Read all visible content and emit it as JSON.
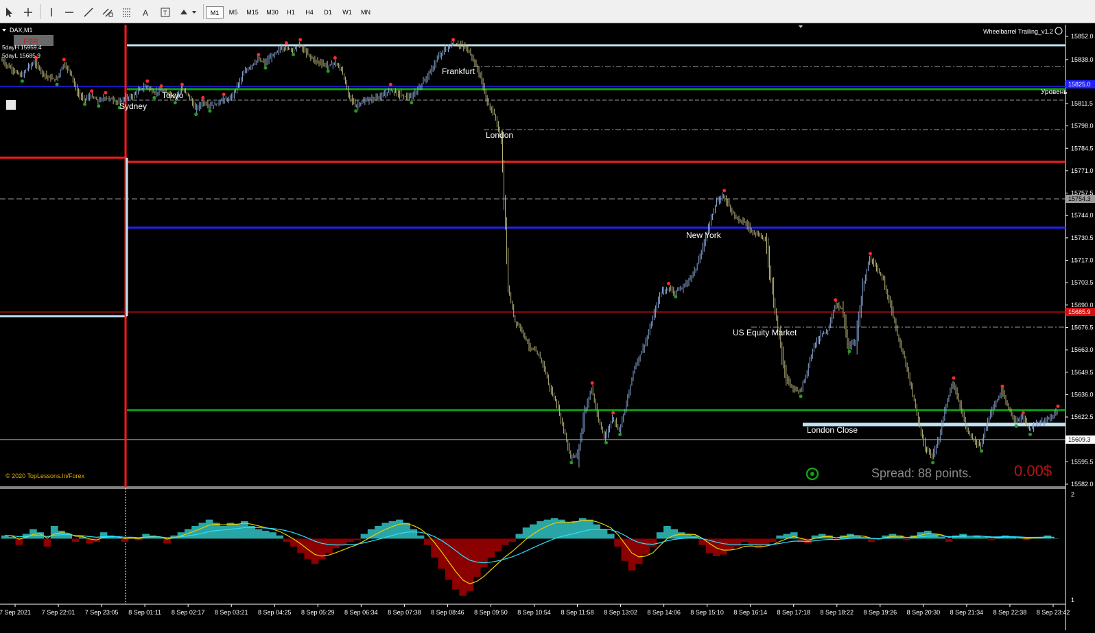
{
  "toolbar": {
    "tools": [
      "cursor-icon",
      "crosshair-icon",
      "vertical-line-icon",
      "horizontal-line-icon",
      "trendline-icon",
      "fibonacci-icon",
      "channel-icon",
      "text-icon",
      "text-label-icon",
      "arrows-icon"
    ],
    "timeframes": [
      "M1",
      "M5",
      "M15",
      "M30",
      "H1",
      "H4",
      "D1",
      "W1",
      "MN"
    ],
    "active_timeframe": "M1"
  },
  "chart": {
    "symbol": "DAX,M1",
    "fsr_badge": "FSR",
    "five_day_high": "5dayH 15959.4",
    "five_day_low": "5dayL 15685.9",
    "ea_name": "Wheelbarrel Trailing_v1.2",
    "copyright": "© 2020 TopLessons.In/Forex",
    "spread_text": "Spread: 88 points.",
    "profit_text": "0.00$",
    "level_label_right": "Уровень",
    "current_price_tag": "15609.3",
    "red_price_tag": "15685.9",
    "grey_price_tag": "15754.3",
    "blue_price_tag": "15825.0",
    "indicator_scale_top": "2",
    "indicator_scale_bottom": "1"
  },
  "sessions": [
    "Sydney",
    "Tokyo",
    "Frankfurt",
    "London",
    "New York",
    "US Equity Market",
    "London Close"
  ],
  "price_axis": [
    "15852.0",
    "15838.0",
    "15811.5",
    "15798.0",
    "15784.5",
    "15771.0",
    "15757.5",
    "15744.0",
    "15730.5",
    "15717.0",
    "15703.5",
    "15690.0",
    "15676.5",
    "15663.0",
    "15649.5",
    "15636.0",
    "15622.5",
    "15609.0",
    "15595.5",
    "15582.0"
  ],
  "time_axis": [
    "7 Sep 2021",
    "7 Sep 22:01",
    "7 Sep 23:05",
    "8 Sep 01:11",
    "8 Sep 02:17",
    "8 Sep 03:21",
    "8 Sep 04:25",
    "8 Sep 05:29",
    "8 Sep 06:34",
    "8 Sep 07:38",
    "8 Sep 08:46",
    "8 Sep 09:50",
    "8 Sep 10:54",
    "8 Sep 11:58",
    "8 Sep 13:02",
    "8 Sep 14:06",
    "8 Sep 15:10",
    "8 Sep 16:14",
    "8 Sep 17:18",
    "8 Sep 18:22",
    "8 Sep 19:26",
    "8 Sep 20:30",
    "8 Sep 21:34",
    "8 Sep 22:38",
    "8 Sep 23:42"
  ],
  "price_series": {
    "time_index": [
      0,
      10,
      20,
      30,
      40,
      50,
      60,
      70,
      80,
      90,
      100,
      110,
      120,
      130,
      140,
      150,
      160,
      170,
      180,
      190,
      200,
      210,
      220,
      230,
      240,
      250,
      260,
      270,
      280,
      290,
      300,
      310,
      320,
      330,
      340,
      350,
      360,
      370,
      380,
      390,
      400,
      410,
      420,
      430,
      440,
      450,
      460,
      470,
      480,
      490,
      500,
      510,
      520,
      530,
      540,
      550,
      560,
      570,
      580,
      590,
      600,
      610,
      620,
      630,
      640,
      650,
      660,
      670,
      680,
      690,
      700,
      710,
      720,
      730,
      740,
      750,
      760,
      770,
      780,
      790,
      800,
      810,
      820,
      830,
      840,
      850,
      860,
      870,
      880,
      890,
      900,
      910,
      920,
      930,
      940,
      950,
      960,
      970,
      980,
      990,
      1000,
      1010,
      1020,
      1030,
      1040,
      1050,
      1060,
      1070,
      1080,
      1090,
      1100,
      1110,
      1120,
      1130,
      1140,
      1150,
      1160,
      1170,
      1180,
      1190,
      1200,
      1210,
      1220,
      1230,
      1240,
      1250,
      1260,
      1270,
      1280,
      1290,
      1300,
      1310,
      1320,
      1330,
      1340,
      1350,
      1360,
      1370,
      1380,
      1390,
      1400,
      1410,
      1420,
      1430,
      1440,
      1450,
      1460,
      1470,
      1480,
      1490,
      1500,
      1510,
      1520
    ],
    "price": [
      15838,
      15834,
      15831,
      15828,
      15834,
      15836,
      15830,
      15827,
      15826,
      15835,
      15831,
      15818,
      15814,
      15816,
      15813,
      15815,
      15814,
      15812,
      15815,
      15816,
      15820,
      15822,
      15818,
      15819,
      15818,
      15815,
      15820,
      15817,
      15808,
      15812,
      15810,
      15811,
      15814,
      15814,
      15822,
      15830,
      15834,
      15838,
      15836,
      15840,
      15844,
      15845,
      15844,
      15847,
      15842,
      15838,
      15836,
      15834,
      15836,
      15832,
      15818,
      15810,
      15812,
      15814,
      15815,
      15816,
      15820,
      15818,
      15816,
      15815,
      15820,
      15826,
      15832,
      15840,
      15844,
      15847,
      15847,
      15845,
      15838,
      15828,
      15812,
      15805,
      15790,
      15700,
      15680,
      15675,
      15665,
      15662,
      15655,
      15640,
      15630,
      15615,
      15598,
      15600,
      15625,
      15640,
      15620,
      15610,
      15622,
      15615,
      15630,
      15650,
      15660,
      15670,
      15685,
      15698,
      15700,
      15698,
      15700,
      15705,
      15712,
      15725,
      15740,
      15752,
      15756,
      15748,
      15742,
      15740,
      15735,
      15732,
      15730,
      15700,
      15670,
      15646,
      15640,
      15638,
      15650,
      15665,
      15672,
      15675,
      15690,
      15688,
      15665,
      15668,
      15700,
      15718,
      15712,
      15705,
      15690,
      15672,
      15658,
      15640,
      15620,
      15604,
      15598,
      15610,
      15630,
      15643,
      15630,
      15615,
      15608,
      15605,
      15620,
      15630,
      15638,
      15627,
      15620,
      15622,
      15615,
      15618,
      15620,
      15622,
      15626,
      15618,
      15612
    ]
  },
  "macd": {
    "histogram": [
      0.2,
      0.1,
      -0.4,
      0.3,
      0.6,
      0.4,
      -0.5,
      0.8,
      0.5,
      0.3,
      -0.2,
      0.1,
      -0.3,
      -0.2,
      0.4,
      0.2,
      0.1,
      -0.2,
      0.1,
      -0.1,
      0.3,
      0.2,
      0.1,
      -0.3,
      0.2,
      0.4,
      0.6,
      0.8,
      1.0,
      1.2,
      1.0,
      0.8,
      1.0,
      0.9,
      1.1,
      0.8,
      0.6,
      0.5,
      0.4,
      0.2,
      -0.2,
      -0.5,
      -0.9,
      -1.3,
      -1.6,
      -1.3,
      -0.9,
      -0.6,
      -0.4,
      -0.2,
      -0.1,
      0.3,
      0.6,
      0.8,
      1.0,
      1.1,
      1.2,
      1.0,
      0.6,
      0.2,
      -0.4,
      -1.2,
      -1.9,
      -2.6,
      -3.2,
      -3.6,
      -3.3,
      -2.4,
      -1.8,
      -1.2,
      -0.8,
      -0.4,
      -0.2,
      0.3,
      0.7,
      0.9,
      1.1,
      1.2,
      1.3,
      1.2,
      1.0,
      1.1,
      1.3,
      1.2,
      0.9,
      0.6,
      0.3,
      -0.5,
      -1.4,
      -2.0,
      -1.6,
      -1.0,
      -0.5,
      0.4,
      0.8,
      0.6,
      0.4,
      0.3,
      0.2,
      -0.4,
      -0.9,
      -1.1,
      -1.0,
      -0.7,
      -0.5,
      -0.2,
      -0.4,
      -0.6,
      -0.4,
      -0.2,
      0.2,
      0.3,
      0.4,
      -0.2,
      -0.3,
      0.2,
      0.3,
      0.2,
      -0.1,
      0.2,
      0.3,
      0.2,
      0.1,
      -0.2,
      -0.1,
      0.2,
      0.3,
      0.2,
      -0.1,
      0.2,
      0.4,
      0.5,
      0.3,
      0.1,
      -0.2,
      0.2,
      0.3,
      0.1,
      0.2,
      0.1,
      -0.1,
      0.1,
      0.2,
      0.1,
      0.0,
      -0.1,
      0.1,
      0.1,
      0.2,
      0.0
    ],
    "ylim": [
      -4,
      3
    ]
  },
  "colors": {
    "bg": "#000000",
    "candle_up": "#8aa8d8",
    "candle_down": "#b7b37a",
    "line_red": "#ff1a1a",
    "line_green": "#0fa30f",
    "line_blue": "#2020ff",
    "line_light": "#bfe3f2",
    "hist_pos": "#2aa5a5",
    "hist_neg": "#8b0000",
    "signal_yellow": "#e8d000",
    "signal_cyan": "#2ce0ff",
    "spread_text": "#8a8a8a",
    "profit_text": "#b81414",
    "copyright_text": "#e0b000"
  }
}
